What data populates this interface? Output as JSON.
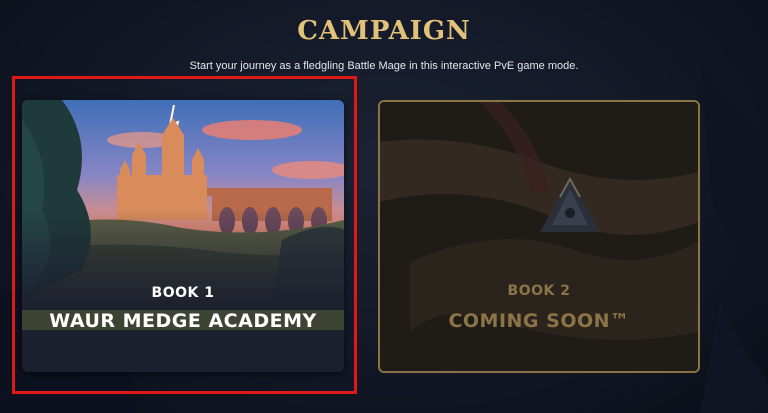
{
  "header": {
    "title": "CAMPAIGN",
    "subtitle": "Start your journey as a fledgling Battle Mage in this interactive PvE game mode."
  },
  "books": [
    {
      "label": "BOOK 1",
      "title": "WAUR MEDGE ACADEMY",
      "state": "available"
    },
    {
      "label": "BOOK 2",
      "title": "COMING SOON™",
      "state": "locked"
    }
  ],
  "colors": {
    "accent_gold": "#e2c27a",
    "locked_text": "#8c7446",
    "selection_outline": "#e01818",
    "background": "#121826"
  }
}
